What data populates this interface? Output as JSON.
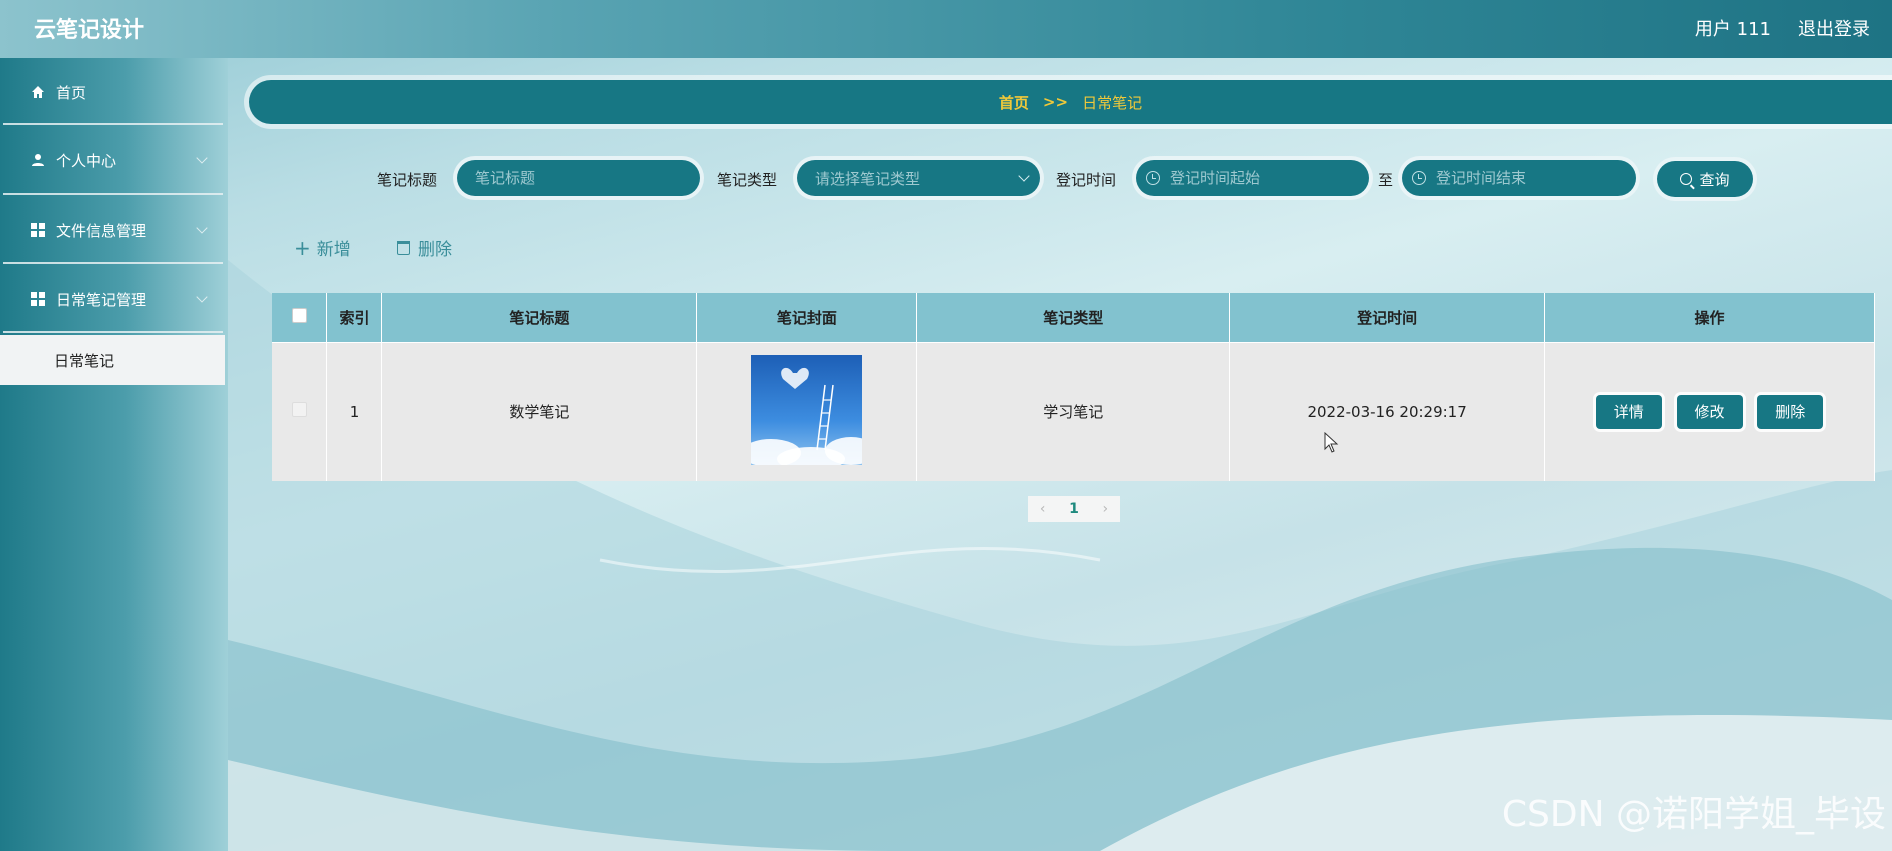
{
  "header": {
    "app_title": "云笔记设计",
    "user_label": "用户 111",
    "logout_label": "退出登录"
  },
  "sidebar": {
    "items": [
      {
        "label": "首页",
        "icon": "home-icon",
        "expandable": false
      },
      {
        "label": "个人中心",
        "icon": "user-icon",
        "expandable": true
      },
      {
        "label": "文件信息管理",
        "icon": "grid-icon",
        "expandable": true
      },
      {
        "label": "日常笔记管理",
        "icon": "grid-icon",
        "expandable": true
      }
    ],
    "active_subitem": "日常笔记"
  },
  "breadcrumb": {
    "home": "首页",
    "separator": ">>",
    "current": "日常笔记"
  },
  "search": {
    "title_label": "笔记标题",
    "title_placeholder": "笔记标题",
    "type_label": "笔记类型",
    "type_placeholder": "请选择笔记类型",
    "time_label": "登记时间",
    "time_start_placeholder": "登记时间起始",
    "time_to": "至",
    "time_end_placeholder": "登记时间结束",
    "search_button": "查询"
  },
  "actions": {
    "add_label": "新增",
    "delete_label": "删除"
  },
  "table": {
    "columns": [
      "索引",
      "笔记标题",
      "笔记封面",
      "笔记类型",
      "登记时间",
      "操作"
    ],
    "rows": [
      {
        "index": "1",
        "title": "数学笔记",
        "type": "学习笔记",
        "time": "2022-03-16 20:29:17",
        "ops": [
          "详情",
          "修改",
          "删除"
        ]
      }
    ]
  },
  "pagination": {
    "current_page": "1"
  },
  "watermark": "CSDN @诺阳学姐_毕设",
  "colors": {
    "primary": "#177784",
    "header_row": "#82c2cf",
    "breadcrumb_text": "#f0c93a"
  }
}
